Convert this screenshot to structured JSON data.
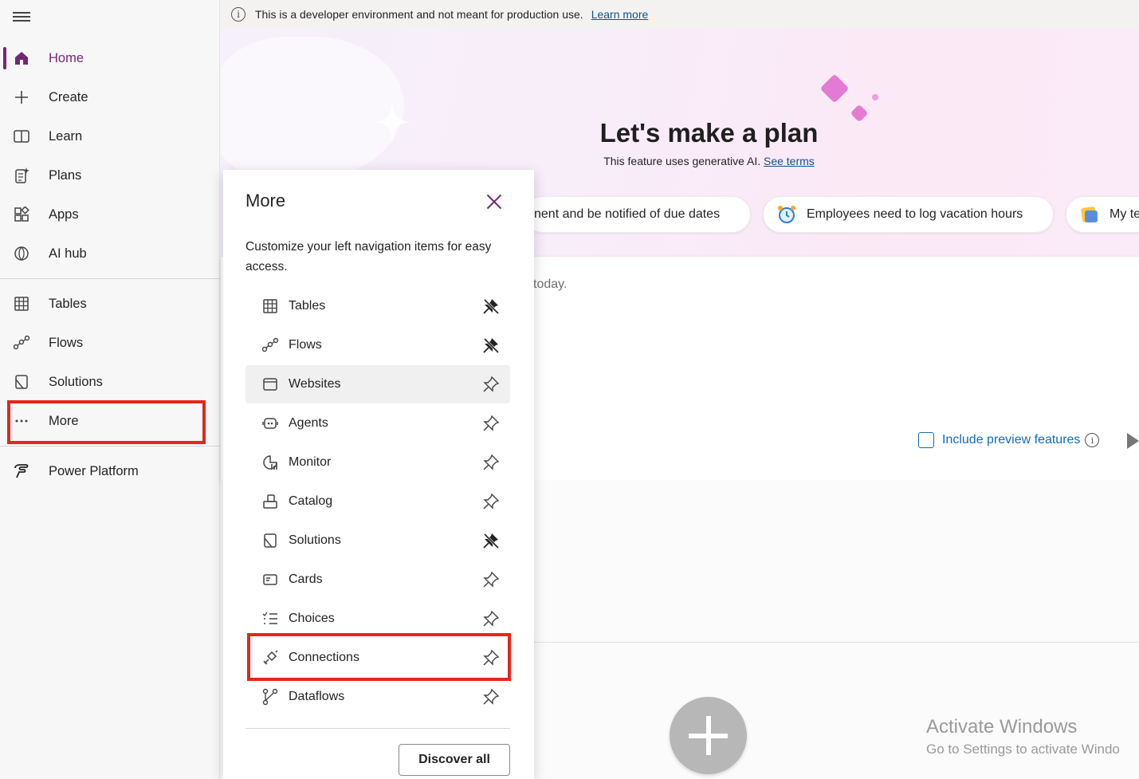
{
  "banner": {
    "message": "This is a developer environment and not meant for production use.",
    "link": "Learn more"
  },
  "leftnav": {
    "items": [
      {
        "label": "Home",
        "icon": "home-icon"
      },
      {
        "label": "Create",
        "icon": "plus-icon"
      },
      {
        "label": "Learn",
        "icon": "book-icon"
      },
      {
        "label": "Plans",
        "icon": "plans-icon"
      },
      {
        "label": "Apps",
        "icon": "apps-icon"
      },
      {
        "label": "AI hub",
        "icon": "ai-hub-icon"
      },
      {
        "label": "Tables",
        "icon": "table-icon"
      },
      {
        "label": "Flows",
        "icon": "flows-icon"
      },
      {
        "label": "Solutions",
        "icon": "solutions-icon"
      },
      {
        "label": "More",
        "icon": "ellipsis-icon"
      },
      {
        "label": "Power Platform",
        "icon": "power-platform-icon"
      }
    ],
    "active": "Home",
    "accent_color": "#742774"
  },
  "hero": {
    "title": "Let's make a plan",
    "subtitle": "This feature uses generative AI.",
    "subtitle_link": "See terms",
    "suggestions": [
      "nent and be notified of due dates",
      "Employees need to log vacation hours",
      "My te"
    ]
  },
  "card": {
    "text": "today.",
    "preview_label": "Include preview features"
  },
  "more_panel": {
    "title": "More",
    "description": "Customize your left navigation items for easy access.",
    "items": [
      {
        "label": "Tables",
        "icon": "table-icon",
        "pinned": true
      },
      {
        "label": "Flows",
        "icon": "flows-icon",
        "pinned": true
      },
      {
        "label": "Websites",
        "icon": "website-icon",
        "pinned": false
      },
      {
        "label": "Agents",
        "icon": "agents-icon",
        "pinned": false
      },
      {
        "label": "Monitor",
        "icon": "monitor-icon",
        "pinned": false
      },
      {
        "label": "Catalog",
        "icon": "catalog-icon",
        "pinned": false
      },
      {
        "label": "Solutions",
        "icon": "solutions-icon",
        "pinned": true
      },
      {
        "label": "Cards",
        "icon": "cards-icon",
        "pinned": false
      },
      {
        "label": "Choices",
        "icon": "choices-icon",
        "pinned": false
      },
      {
        "label": "Connections",
        "icon": "connections-icon",
        "pinned": false
      },
      {
        "label": "Dataflows",
        "icon": "dataflows-icon",
        "pinned": false
      }
    ],
    "discover_label": "Discover all"
  },
  "watermark": {
    "line1": "Activate Windows",
    "line2": "Go to Settings to activate Windo"
  },
  "highlight_color": "#e5261b"
}
